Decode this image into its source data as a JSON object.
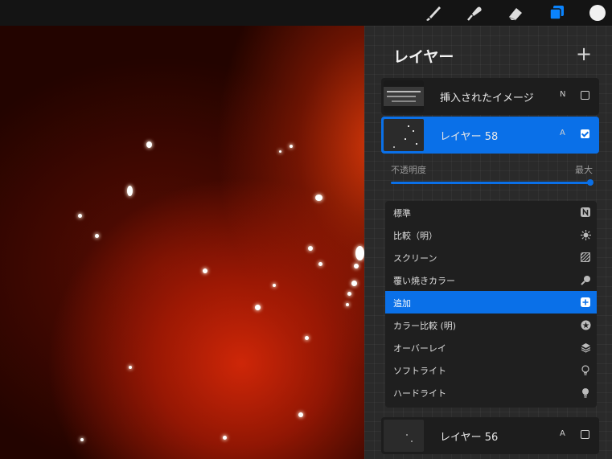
{
  "toolbar": {
    "tools": [
      {
        "icon": "brush-icon"
      },
      {
        "icon": "smudge-icon"
      },
      {
        "icon": "eraser-icon"
      },
      {
        "icon": "layers-icon",
        "active": true
      },
      {
        "icon": "color-swatch-icon"
      }
    ],
    "accent_color": "#0a84ff"
  },
  "layers_panel": {
    "title": "レイヤー",
    "add_label": "+",
    "layers": [
      {
        "name": "挿入されたイメージ",
        "blend": "N",
        "visible": false,
        "selected": false
      },
      {
        "name": "レイヤー 58",
        "blend": "A",
        "visible": true,
        "selected": true
      },
      {
        "name": "レイヤー 56",
        "blend": "A",
        "visible": false,
        "selected": false
      }
    ],
    "opacity": {
      "label": "不透明度",
      "max_label": "最大",
      "value_percent": 100
    },
    "blend_modes": [
      {
        "label": "標準",
        "icon": "normal-n-icon"
      },
      {
        "label": "比較（明）",
        "icon": "sunburst-icon"
      },
      {
        "label": "スクリーン",
        "icon": "hatch-icon"
      },
      {
        "label": "覆い焼きカラー",
        "icon": "magnify-icon"
      },
      {
        "label": "追加",
        "icon": "plus-square-icon",
        "active": true
      },
      {
        "label": "カラー比較 (明)",
        "icon": "star-circle-icon"
      },
      {
        "label": "オーバーレイ",
        "icon": "stack-icon"
      },
      {
        "label": "ソフトライト",
        "icon": "bulb-icon"
      },
      {
        "label": "ハードライト",
        "icon": "bulb-solid-icon"
      }
    ]
  }
}
